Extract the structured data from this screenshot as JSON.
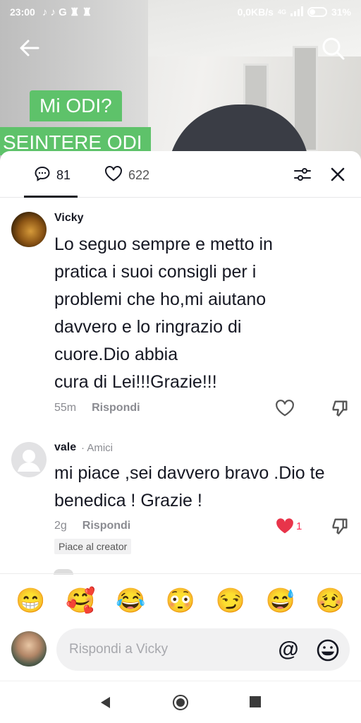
{
  "status_bar": {
    "time": "23:00",
    "notification_icons": "♪ ♪ G ♜ ♜",
    "network_speed": "0,0KB/s",
    "network_type": "4G",
    "battery": "31%"
  },
  "video_overlay": {
    "line1": "Mi ODI?",
    "line2": "SEINTERE ODI"
  },
  "panel": {
    "comments_count": "81",
    "likes_count": "622"
  },
  "comments": [
    {
      "username": "Vicky",
      "text": "Lo seguo sempre e metto in pratica i suoi consigli per i problemi che ho,mi aiutano davvero e lo ringrazio di cuore.Dio abbia\ncura di Lei!!!Grazie!!!",
      "time": "55m",
      "reply_label": "Rispondi"
    },
    {
      "username": "vale",
      "tag": "· Amici",
      "text": "mi piace ,sei davvero bravo .Dio te benedica ! Grazie !",
      "time": "2g",
      "reply_label": "Rispondi",
      "like_count": "1",
      "creator_badge": "Piace al creator"
    }
  ],
  "emojis": [
    "😁",
    "🥰",
    "😂",
    "😳",
    "😏",
    "😅",
    "🥴"
  ],
  "reply": {
    "placeholder": "Rispondi a Vicky",
    "mention_symbol": "@"
  },
  "colors": {
    "accent_red": "#fe2c55",
    "overlay_green": "#5ec26a",
    "muted_text": "#8a8b91"
  }
}
